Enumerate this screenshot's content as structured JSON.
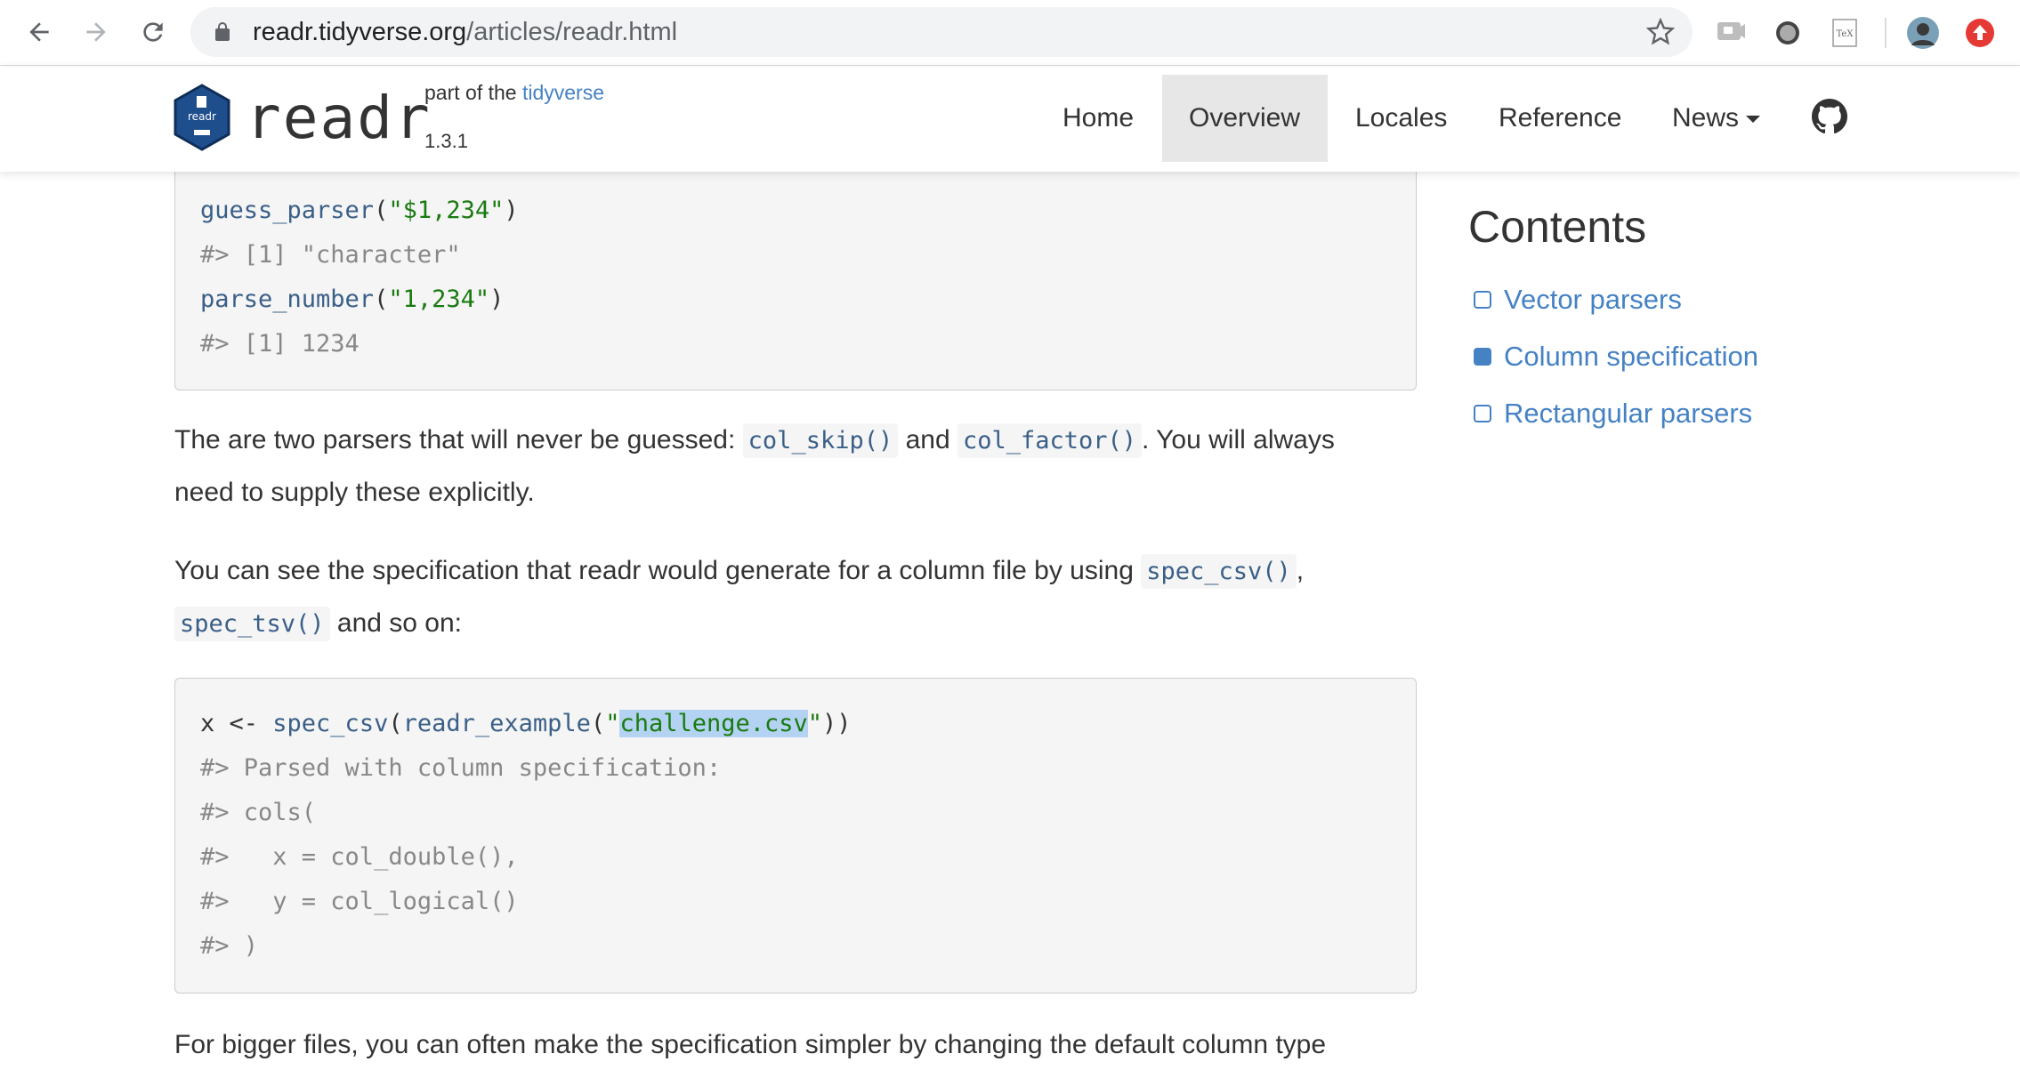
{
  "browser": {
    "url_host": "readr.tidyverse.org",
    "url_path": "/articles/readr.html",
    "extensions": [
      "comment-extension-icon",
      "circle-extension-icon",
      "tex-extension-icon",
      "profile-avatar",
      "upload-extension-icon"
    ]
  },
  "site": {
    "logo_text": "readr",
    "brand": "readr",
    "tagline_prefix": "part of the ",
    "tagline_link": "tidyverse",
    "version": "1.3.1",
    "nav": [
      {
        "label": "Home",
        "active": false
      },
      {
        "label": "Overview",
        "active": true
      },
      {
        "label": "Locales",
        "active": false
      },
      {
        "label": "Reference",
        "active": false
      },
      {
        "label": "News",
        "active": false,
        "dropdown": true
      }
    ]
  },
  "content": {
    "code1": {
      "line1_fn": "guess_parser",
      "line1_open": "(",
      "line1_str": "\"$1,234\"",
      "line1_close": ")",
      "line2": "#> [1] \"character\"",
      "line3_fn": "parse_number",
      "line3_open": "(",
      "line3_str": "\"1,234\"",
      "line3_close": ")",
      "line4": "#> [1] 1234"
    },
    "para1": {
      "t1": "The are two parsers that will never be guessed: ",
      "c1": "col_skip()",
      "t2": " and ",
      "c2": "col_factor()",
      "t3": ". You will always",
      "t4": "need to supply these explicitly."
    },
    "para2": {
      "t1": "You can see the specification that readr would generate for a column file by using ",
      "c1": "spec_csv()",
      "t2": ",",
      "c2": "spec_tsv()",
      "t3": " and so on:"
    },
    "code2": {
      "l1_a": "x <- ",
      "l1_fn": "spec_csv",
      "l1_b": "(",
      "l1_fn2": "readr_example",
      "l1_c": "(",
      "l1_q1": "\"",
      "l1_sel": "challenge.csv",
      "l1_q2": "\"",
      "l1_d": "))",
      "l2": "#> Parsed with column specification:",
      "l3": "#> cols(",
      "l4": "#>   x = col_double(),",
      "l5": "#>   y = col_logical()",
      "l6": "#> )"
    },
    "para3": "For bigger files, you can often make the specification simpler by changing the default column type"
  },
  "sidebar": {
    "title": "Contents",
    "items": [
      {
        "label": "Vector parsers",
        "active": false
      },
      {
        "label": "Column specification",
        "active": true
      },
      {
        "label": "Rectangular parsers",
        "active": false
      }
    ]
  },
  "colors": {
    "link": "#4582c4",
    "code_fn": "#3a5f88",
    "code_string": "#1a7a10",
    "code_comment": "#888888",
    "selection": "#b4d3f2"
  }
}
